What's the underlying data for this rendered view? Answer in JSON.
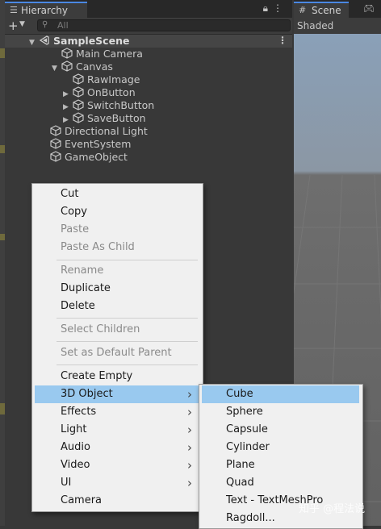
{
  "hierarchy": {
    "tab_label": "Hierarchy",
    "search_placeholder": "All",
    "scene_name": "SampleScene",
    "items": [
      {
        "label": "Main Camera",
        "depth": 1,
        "expandable": false
      },
      {
        "label": "Canvas",
        "depth": 1,
        "expandable": true,
        "expanded": true
      },
      {
        "label": "RawImage",
        "depth": 2,
        "expandable": false
      },
      {
        "label": "OnButton",
        "depth": 2,
        "expandable": true
      },
      {
        "label": "SwitchButton",
        "depth": 2,
        "expandable": true
      },
      {
        "label": "SaveButton",
        "depth": 2,
        "expandable": true
      },
      {
        "label": "Directional Light",
        "depth": 0,
        "expandable": false
      },
      {
        "label": "EventSystem",
        "depth": 0,
        "expandable": false
      },
      {
        "label": "GameObject",
        "depth": 0,
        "expandable": false
      }
    ]
  },
  "scene_panel": {
    "tab_label": "Scene",
    "shading_mode": "Shaded"
  },
  "context_menu": {
    "items": [
      {
        "label": "Cut",
        "enabled": true
      },
      {
        "label": "Copy",
        "enabled": true
      },
      {
        "label": "Paste",
        "enabled": false
      },
      {
        "label": "Paste As Child",
        "enabled": false
      },
      {
        "label": "Rename",
        "enabled": false
      },
      {
        "label": "Duplicate",
        "enabled": true
      },
      {
        "label": "Delete",
        "enabled": true
      },
      {
        "label": "Select Children",
        "enabled": false
      },
      {
        "label": "Set as Default Parent",
        "enabled": false
      },
      {
        "label": "Create Empty",
        "enabled": true
      },
      {
        "label": "3D Object",
        "enabled": true,
        "submenu": true,
        "highlighted": true
      },
      {
        "label": "Effects",
        "enabled": true,
        "submenu": true
      },
      {
        "label": "Light",
        "enabled": true,
        "submenu": true
      },
      {
        "label": "Audio",
        "enabled": true,
        "submenu": true
      },
      {
        "label": "Video",
        "enabled": true,
        "submenu": true
      },
      {
        "label": "UI",
        "enabled": true,
        "submenu": true
      },
      {
        "label": "Camera",
        "enabled": true
      }
    ]
  },
  "submenu_3d_object": {
    "items": [
      {
        "label": "Cube",
        "highlighted": true
      },
      {
        "label": "Sphere"
      },
      {
        "label": "Capsule"
      },
      {
        "label": "Cylinder"
      },
      {
        "label": "Plane"
      },
      {
        "label": "Quad"
      },
      {
        "label": "Text - TextMeshPro"
      },
      {
        "label": "Ragdoll..."
      }
    ]
  },
  "watermark": "知乎 @程法说",
  "colors": {
    "menu_highlight": "#99c9ef",
    "tab_accent": "#4a88e3",
    "panel_bg": "#383838",
    "menu_bg": "#f0f0f0"
  }
}
